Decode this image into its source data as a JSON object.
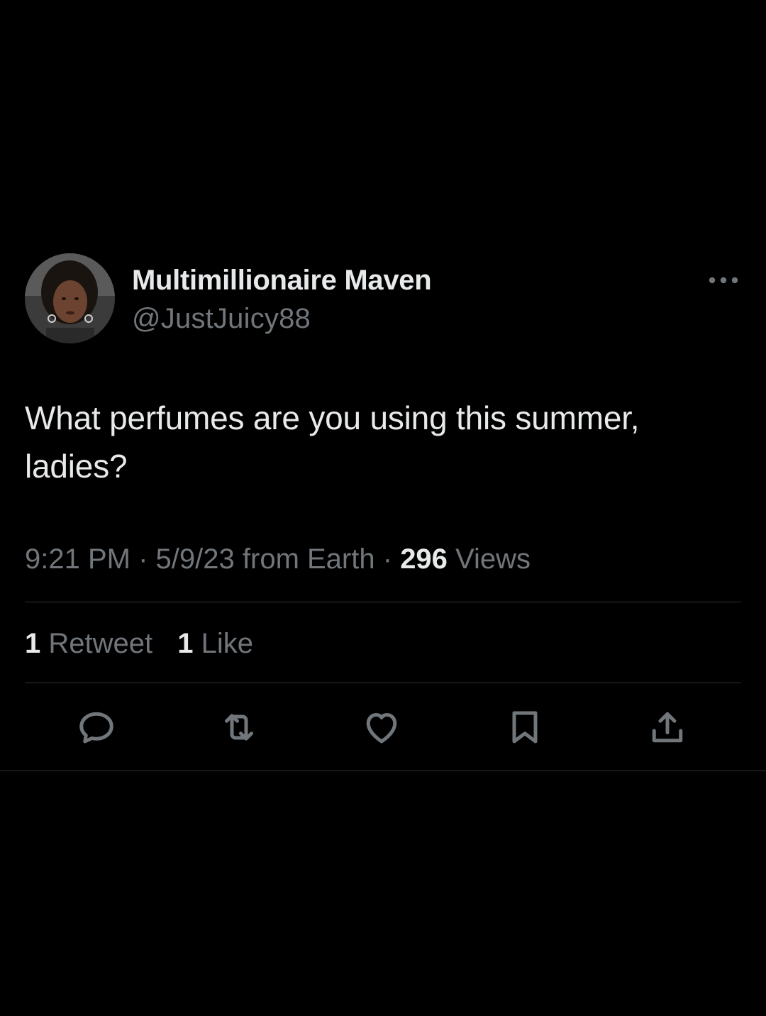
{
  "tweet": {
    "display_name": "Multimillionaire Maven",
    "handle": "@JustJuicy88",
    "text": "What perfumes are you using this summer, ladies?",
    "time": "9:21 PM",
    "date": "5/9/23",
    "source": "from Earth",
    "separator": "·",
    "views_count": "296",
    "views_label": "Views",
    "retweets_count": "1",
    "retweets_label": "Retweet",
    "likes_count": "1",
    "likes_label": "Like"
  },
  "icons": {
    "more": "more-dots-icon",
    "reply": "reply-icon",
    "retweet": "retweet-icon",
    "like": "heart-icon",
    "bookmark": "bookmark-icon",
    "share": "share-icon"
  },
  "colors": {
    "background": "#000000",
    "primary_text": "#e7e9ea",
    "secondary_text": "#71767b",
    "divider": "#2f3336"
  }
}
